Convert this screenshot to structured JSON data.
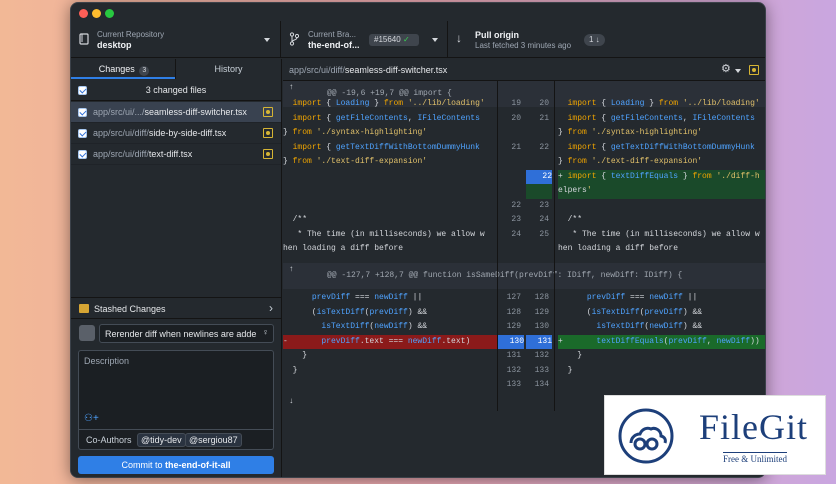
{
  "window": {
    "controls": [
      "close",
      "minimize",
      "zoom"
    ]
  },
  "toolbar": {
    "repo_label": "Current Repository",
    "repo_name": "desktop",
    "branch_label": "Current Bra...",
    "branch_name": "the-end-of...",
    "pr_badge": "#15640",
    "pull_title": "Pull origin",
    "pull_sub": "Last fetched 3 minutes ago",
    "pull_count": "1"
  },
  "sidebar": {
    "tab_changes": "Changes",
    "changes_count": "3",
    "tab_history": "History",
    "changed_files": "3 changed files",
    "files": [
      {
        "dir": "app/src/ui/.../",
        "name": "seamless-diff-switcher.tsx"
      },
      {
        "dir": "app/src/ui/diff/",
        "name": "side-by-side-diff.tsx"
      },
      {
        "dir": "app/src/ui/diff/",
        "name": "text-diff.tsx"
      }
    ],
    "stashed": "Stashed Changes",
    "summary": "Rerender diff when newlines are adde",
    "description_placeholder": "Description",
    "coauthors_label": "Co-Authors",
    "coauthors": [
      "@tidy-dev",
      "@sergiou87"
    ],
    "commit_prefix": "Commit to",
    "commit_branch": "the-end-of-it-all"
  },
  "diff": {
    "path_dim": "app/src/ui/diff/",
    "path_file": "seamless-diff-switcher.tsx",
    "hunk1": "@@ -19,6 +19,7 @@ import {",
    "hunk2": "@@ -127,7 +128,7 @@ function isSameDiff(prevDiff: IDiff, newDiff: IDiff) {",
    "rows": [
      {
        "l": "19",
        "r": "20",
        "lt": "  import { Loading } from '../lib/loading'",
        "rt": "  import { Loading } from '../lib/loading'"
      },
      {
        "l": "20",
        "r": "21",
        "lt": "  import { getFileContents, IFileContents",
        "rt": "  import { getFileContents, IFileContents"
      },
      {
        "l": "",
        "r": "",
        "lt": "} from './syntax-highlighting'",
        "rt": "} from './syntax-highlighting'"
      },
      {
        "l": "21",
        "r": "22",
        "lt": "  import { getTextDiffWithBottomDummyHunk",
        "rt": "  import { getTextDiffWithBottomDummyHunk"
      },
      {
        "l": "",
        "r": "",
        "lt": "} from './text-diff-expansion'",
        "rt": "} from './text-diff-expansion'"
      },
      {
        "l": "",
        "r": "22",
        "lt": "",
        "rt": "+ import { textDiffEquals } from './diff-h"
      },
      {
        "l": "",
        "r": "",
        "lt": "",
        "rt": "elpers'"
      },
      {
        "l": "22",
        "r": "23",
        "lt": "",
        "rt": ""
      },
      {
        "l": "23",
        "r": "24",
        "lt": "  /**",
        "rt": "  /**"
      },
      {
        "l": "24",
        "r": "25",
        "lt": "   * The time (in milliseconds) we allow w",
        "rt": "   * The time (in milliseconds) we allow w"
      },
      {
        "l": "",
        "r": "",
        "lt": "hen loading a diff before",
        "rt": "hen loading a diff before"
      }
    ],
    "rows2": [
      {
        "l": "127",
        "r": "128",
        "lt": "      prevDiff === newDiff ||",
        "rt": "      prevDiff === newDiff ||"
      },
      {
        "l": "128",
        "r": "129",
        "lt": "      (isTextDiff(prevDiff) &&",
        "rt": "      (isTextDiff(prevDiff) &&"
      },
      {
        "l": "129",
        "r": "130",
        "lt": "        isTextDiff(newDiff) &&",
        "rt": "        isTextDiff(newDiff) &&"
      },
      {
        "l": "130",
        "r": "131",
        "lt": "-       prevDiff.text === newDiff.text)",
        "rt": "+       textDiffEquals(prevDiff, newDiff))"
      },
      {
        "l": "131",
        "r": "132",
        "lt": "    }",
        "rt": "    }"
      },
      {
        "l": "132",
        "r": "133",
        "lt": "  }",
        "rt": "  }"
      },
      {
        "l": "133",
        "r": "134",
        "lt": "",
        "rt": ""
      }
    ]
  },
  "watermark": {
    "brand": "FileGit",
    "tagline": "Free & Unlimited"
  }
}
